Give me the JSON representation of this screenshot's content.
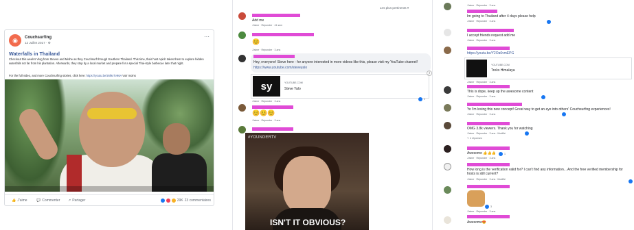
{
  "post": {
    "page_name": "Couchsurfing",
    "date": "12 Juillet 2017 · ⚙",
    "more": "···",
    "title": "Waterfalls in Thailand",
    "text": "Checkout this week's Vlog from Steven and Mishe as they Couchsurf through Southern Thailand. This time, their host Apich takes them to explore hidden waterfalls not far from his plantation. Afterwards, they stop by a local market and prepare for a special Thai-style barbecue later that night.",
    "link_prefix": "For the full video, and more Couchsurfing stories, click here:",
    "link_url": "https://youtu.be/z6l9xTv96A",
    "link_more": "Voir moins",
    "like": "J'aime",
    "comment": "Commenter",
    "share": "Partager",
    "reactions_count": "29K",
    "comments_count": "23 commentaires"
  },
  "middle": {
    "sort": "Les plus pertinents ▾",
    "c1_text": "Add me",
    "c1_meta": "J'aime · Répondre · 41 sem",
    "c2_emoji": "😊",
    "c2_meta": "J'aime · Répondre · 3 ans",
    "c3_text": "Hey, everyone! Steve here - for anyone interested in more videos like this, please visit my YouTube channel!",
    "c3_link": "https://www.youtube.com/steveyalo",
    "c3_card_source": "YOUTUBE.COM",
    "c3_card_title": "Steve Yalo",
    "c3_meta": "J'aime · Répondre · 3 ans",
    "c3_count": "2",
    "c4_emoji": "😊😊😊",
    "c4_meta": "J'aime · Répondre · 3 ans",
    "gif_tag": "#YOUNGERTV",
    "gif_caption": "ISN'T IT OBVIOUS?"
  },
  "right": {
    "r1_meta": "J'aime · Répondre · 3 ans",
    "r2_text": "Im going to Thailand after 4 days please help",
    "r2_meta": "J'aime · Répondre · 3 ans",
    "r3_text": "I accept friends request add me",
    "r3_meta": "J'aime · Répondre · 3 ans",
    "r4_link": "https://youtu.be/Y2Oa6vmEPG",
    "yt_source": "YOUTUBE.COM",
    "yt_title": "Treks Himalaya",
    "r4_meta": "J'aime · Répondre · 3 ans",
    "r5_text": "This is dope, keep up the awesome content",
    "r5_meta": "J'aime · Répondre · 3 ans",
    "r6_text": "Yo I'm loving this new concept! Great way to get an eye into others' Couchsurfing experiences!",
    "r6_meta": "J'aime · Répondre · 3 ans",
    "r7_text": "OMG 3.8k viewers. Thank you for watching",
    "r7_meta": "J'aime · Répondre · 3 ans · Modifié",
    "r7_replies": "↪ 4 réponses",
    "r8_text": "Awesome 👍👍👍",
    "r8_count": "1",
    "r8_meta": "J'aime · Répondre · 3 ans",
    "r9_text": "How long is the verification valid for? I can't find any information... And the free verified membership for hosts is still current?",
    "r9_meta": "J'aime · Répondre · 3 ans · Modifié",
    "r10_count": "3",
    "r10_meta": "J'aime · Répondre · 3 ans",
    "r11_text": "Awesome😍"
  },
  "colors": {
    "brand": "#f26b4d",
    "link": "#385898",
    "redaction": "#e04bd6",
    "like_blue": "#1877f2"
  }
}
